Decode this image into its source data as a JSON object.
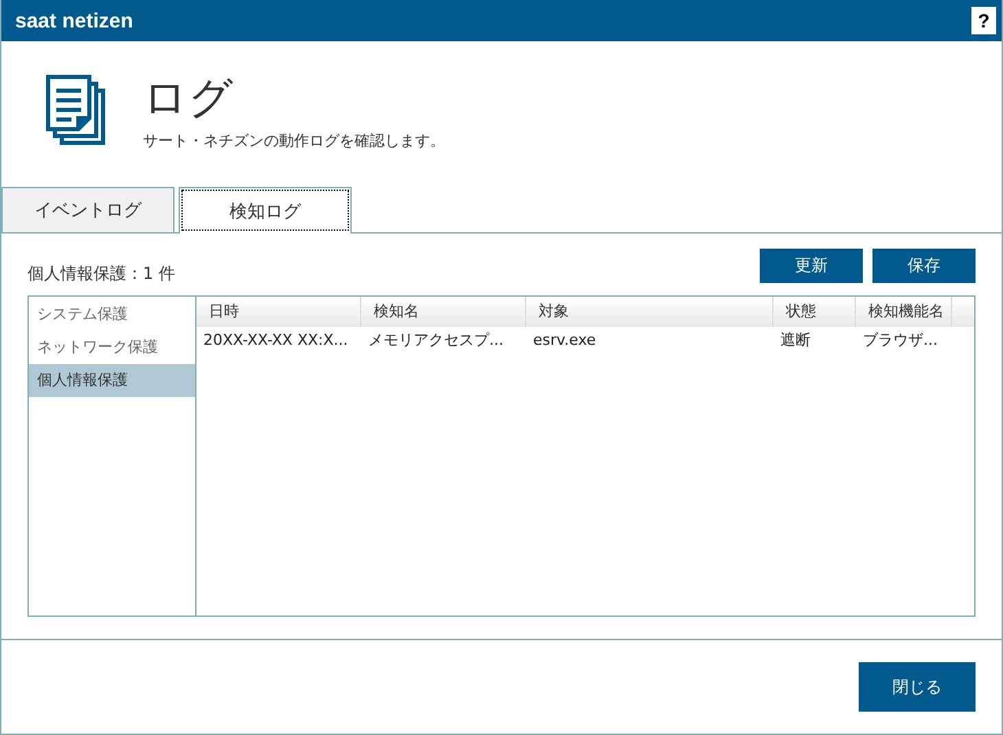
{
  "window": {
    "title": "saat netizen",
    "help": "?"
  },
  "header": {
    "title": "ログ",
    "subtitle": "サート・ネチズンの動作ログを確認します。"
  },
  "tabs": [
    {
      "label": "イベントログ",
      "selected": false
    },
    {
      "label": "検知ログ",
      "selected": true
    }
  ],
  "summary": "個人情報保護：1 件",
  "actions": [
    "更新",
    "保存"
  ],
  "sidebar": {
    "items": [
      {
        "label": "システム保護",
        "selected": false
      },
      {
        "label": "ネットワーク保護",
        "selected": false
      },
      {
        "label": "個人情報保護",
        "selected": true
      }
    ]
  },
  "table": {
    "columns": [
      "日時",
      "検知名",
      "対象",
      "状態",
      "検知機能名"
    ],
    "rows": [
      [
        "20XX-XX-XX XX:X...",
        "メモリアクセスプ...",
        "esrv.exe",
        "遮断",
        "ブラウザ..."
      ]
    ]
  },
  "footer": {
    "button": "閉じる"
  }
}
